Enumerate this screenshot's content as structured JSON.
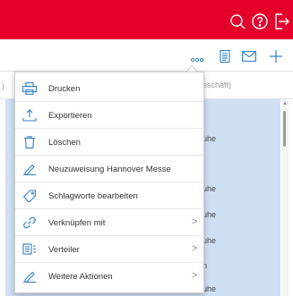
{
  "colors": {
    "brand_red": "#e4002b",
    "accent_blue": "#2f80c8",
    "list_selection": "#cfe0f4"
  },
  "header": {
    "icons": [
      "search-icon",
      "help-icon",
      "logout-icon"
    ]
  },
  "toolbar": {
    "icons": [
      "more-icon",
      "document-icon",
      "mail-icon",
      "add-icon"
    ]
  },
  "background": {
    "header_paren": ")",
    "header_tail": "eschäft)",
    "cells": [
      "uhe",
      "uhe",
      "uhe",
      "uhe",
      "n",
      "uhe"
    ]
  },
  "menu": {
    "items": [
      {
        "label": "Drucken",
        "icon": "printer-icon",
        "has_submenu": false
      },
      {
        "label": "Exportieren",
        "icon": "export-icon",
        "has_submenu": false
      },
      {
        "label": "Löschen",
        "icon": "trash-icon",
        "has_submenu": false
      },
      {
        "label": "Neuzuweisung Hannover Messe",
        "icon": "pen-icon",
        "has_submenu": false
      },
      {
        "label": "Schlagworte bearbeiten",
        "icon": "tag-icon",
        "has_submenu": false
      },
      {
        "label": "Verknüpfen mit",
        "icon": "link-icon",
        "has_submenu": true
      },
      {
        "label": "Verteiler",
        "icon": "distribution-icon",
        "has_submenu": true
      },
      {
        "label": "Weitere Aktionen",
        "icon": "pen-icon",
        "has_submenu": true
      }
    ]
  }
}
